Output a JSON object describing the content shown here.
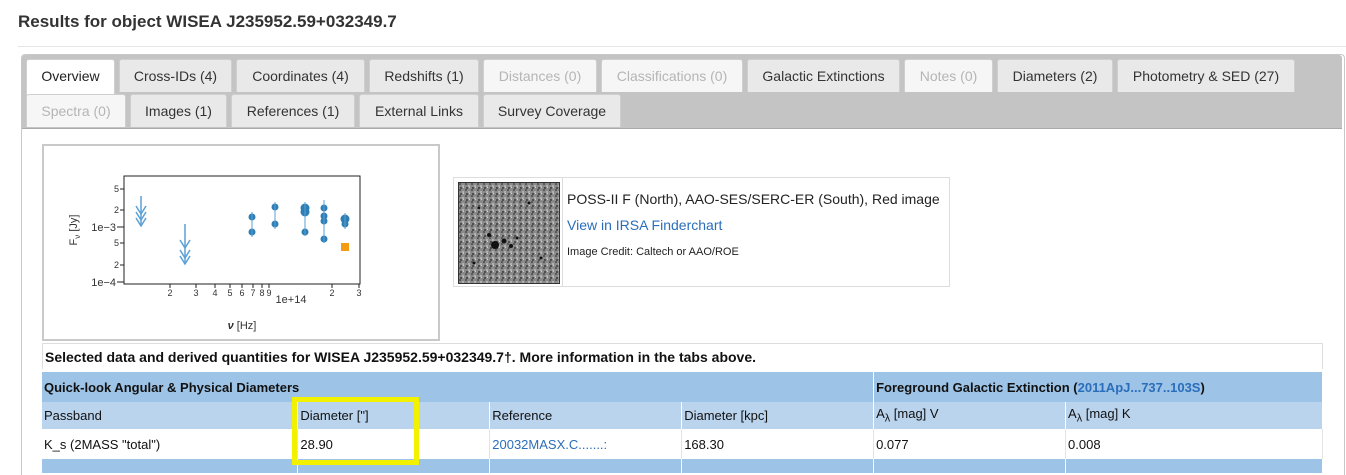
{
  "page": {
    "title": "Results for object WISEA J235952.59+032349.7"
  },
  "tabs": [
    {
      "label": "Overview",
      "state": "active"
    },
    {
      "label": "Cross-IDs (4)",
      "state": "normal"
    },
    {
      "label": "Coordinates (4)",
      "state": "normal"
    },
    {
      "label": "Redshifts (1)",
      "state": "normal"
    },
    {
      "label": "Distances (0)",
      "state": "disabled"
    },
    {
      "label": "Classifications (0)",
      "state": "disabled"
    },
    {
      "label": "Galactic Extinctions",
      "state": "normal"
    },
    {
      "label": "Notes (0)",
      "state": "disabled"
    },
    {
      "label": "Diameters (2)",
      "state": "normal"
    },
    {
      "label": "Photometry & SED (27)",
      "state": "normal"
    },
    {
      "label": "Spectra (0)",
      "state": "disabled"
    },
    {
      "label": "Images (1)",
      "state": "normal"
    },
    {
      "label": "References (1)",
      "state": "normal"
    },
    {
      "label": "External Links",
      "state": "normal"
    },
    {
      "label": "Survey Coverage",
      "state": "normal"
    }
  ],
  "sed_plot": {
    "y_label": "F",
    "y_label_sub": "ν",
    "y_label_unit": " [Jy]",
    "x_label": "ν",
    "x_label_unit": " [Hz]",
    "x_offset_label": "1e+14",
    "y_ticks": [
      "5",
      "2",
      "1e−3",
      "5",
      "2",
      "1e−4"
    ],
    "x_ticks": [
      "2",
      "3",
      "4",
      "5",
      "6",
      "7",
      "8",
      "9",
      "2",
      "3"
    ],
    "colors": {
      "points": "#2f7fb5",
      "limits": "#5aa0d6",
      "highlight": "#f39c12"
    }
  },
  "image_panel": {
    "caption": "POSS-II F (North), AAO-SES/SERC-ER (South), Red image",
    "link": "View in IRSA Finderchart",
    "credit": "Image Credit: Caltech or AAO/ROE"
  },
  "summary": {
    "heading": "Selected data and derived quantities for WISEA J235952.59+032349.7†.  More information in the tabs above."
  },
  "diameters": {
    "section_title": "Quick-look Angular & Physical Diameters",
    "extinction_prefix": "Foreground Galactic Extinction (",
    "extinction_ref": "2011ApJ...737..103S",
    "extinction_suffix": ")",
    "columns": [
      "Passband",
      "Diameter [\"]",
      "Reference",
      "Diameter [kpc]",
      "A",
      "A"
    ],
    "col_sub": "λ",
    "col_tail": [
      " [mag] V",
      " [mag] K"
    ],
    "row": {
      "passband": "K_s (2MASS \"total\")",
      "diameter_arcsec": "28.90",
      "reference": "20032MASX.C.......:",
      "diameter_kpc": "168.30",
      "a_v": "0.077",
      "a_k": "0.008"
    }
  }
}
